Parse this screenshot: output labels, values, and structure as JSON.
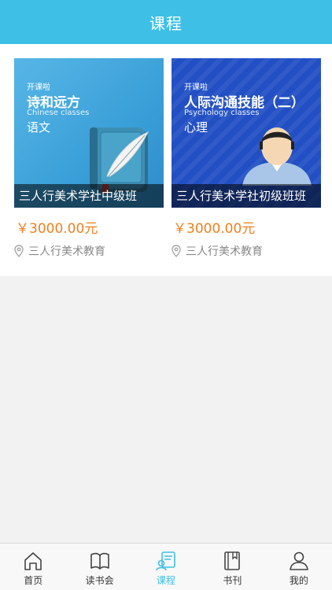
{
  "header": {
    "title": "课程"
  },
  "courses": [
    {
      "cover_small": "开课啦",
      "cover_title": "诗和远方",
      "cover_en": "Chinese classes",
      "cover_subject": "语文",
      "caption": "三人行美术学社中级班",
      "price": "￥3000.00元",
      "location": "三人行美术教育",
      "icon": "book-feather-icon"
    },
    {
      "cover_small": "开课啦",
      "cover_title": "人际沟通技能（二）",
      "cover_en": "Psychology classes",
      "cover_subject": "心理",
      "caption": "三人行美术学社初级班班",
      "price": "￥3000.00元",
      "location": "三人行美术教育",
      "icon": "person-avatar-icon"
    }
  ],
  "tabs": [
    {
      "label": "首页",
      "icon": "home-icon",
      "active": false
    },
    {
      "label": "读书会",
      "icon": "open-book-icon",
      "active": false
    },
    {
      "label": "课程",
      "icon": "course-icon",
      "active": true
    },
    {
      "label": "书刊",
      "icon": "bookmark-book-icon",
      "active": false
    },
    {
      "label": "我的",
      "icon": "profile-icon",
      "active": false
    }
  ],
  "colors": {
    "accent": "#3ec0e6",
    "price": "#f07f1e"
  }
}
